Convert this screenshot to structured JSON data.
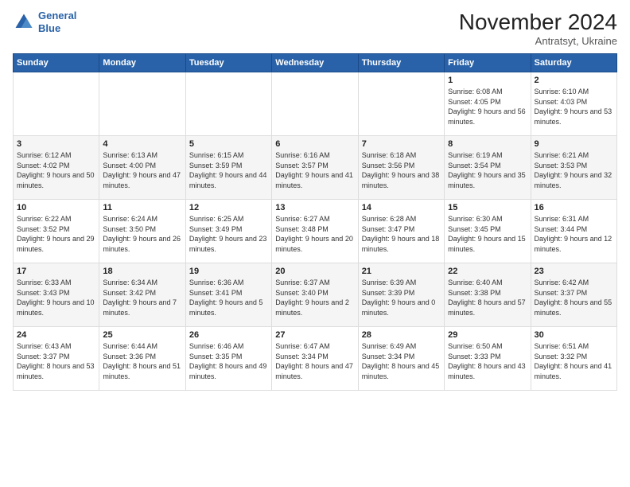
{
  "logo": {
    "line1": "General",
    "line2": "Blue"
  },
  "title": "November 2024",
  "subtitle": "Antratsyt, Ukraine",
  "headers": [
    "Sunday",
    "Monday",
    "Tuesday",
    "Wednesday",
    "Thursday",
    "Friday",
    "Saturday"
  ],
  "weeks": [
    [
      {
        "day": "",
        "info": ""
      },
      {
        "day": "",
        "info": ""
      },
      {
        "day": "",
        "info": ""
      },
      {
        "day": "",
        "info": ""
      },
      {
        "day": "",
        "info": ""
      },
      {
        "day": "1",
        "info": "Sunrise: 6:08 AM\nSunset: 4:05 PM\nDaylight: 9 hours and 56 minutes."
      },
      {
        "day": "2",
        "info": "Sunrise: 6:10 AM\nSunset: 4:03 PM\nDaylight: 9 hours and 53 minutes."
      }
    ],
    [
      {
        "day": "3",
        "info": "Sunrise: 6:12 AM\nSunset: 4:02 PM\nDaylight: 9 hours and 50 minutes."
      },
      {
        "day": "4",
        "info": "Sunrise: 6:13 AM\nSunset: 4:00 PM\nDaylight: 9 hours and 47 minutes."
      },
      {
        "day": "5",
        "info": "Sunrise: 6:15 AM\nSunset: 3:59 PM\nDaylight: 9 hours and 44 minutes."
      },
      {
        "day": "6",
        "info": "Sunrise: 6:16 AM\nSunset: 3:57 PM\nDaylight: 9 hours and 41 minutes."
      },
      {
        "day": "7",
        "info": "Sunrise: 6:18 AM\nSunset: 3:56 PM\nDaylight: 9 hours and 38 minutes."
      },
      {
        "day": "8",
        "info": "Sunrise: 6:19 AM\nSunset: 3:54 PM\nDaylight: 9 hours and 35 minutes."
      },
      {
        "day": "9",
        "info": "Sunrise: 6:21 AM\nSunset: 3:53 PM\nDaylight: 9 hours and 32 minutes."
      }
    ],
    [
      {
        "day": "10",
        "info": "Sunrise: 6:22 AM\nSunset: 3:52 PM\nDaylight: 9 hours and 29 minutes."
      },
      {
        "day": "11",
        "info": "Sunrise: 6:24 AM\nSunset: 3:50 PM\nDaylight: 9 hours and 26 minutes."
      },
      {
        "day": "12",
        "info": "Sunrise: 6:25 AM\nSunset: 3:49 PM\nDaylight: 9 hours and 23 minutes."
      },
      {
        "day": "13",
        "info": "Sunrise: 6:27 AM\nSunset: 3:48 PM\nDaylight: 9 hours and 20 minutes."
      },
      {
        "day": "14",
        "info": "Sunrise: 6:28 AM\nSunset: 3:47 PM\nDaylight: 9 hours and 18 minutes."
      },
      {
        "day": "15",
        "info": "Sunrise: 6:30 AM\nSunset: 3:45 PM\nDaylight: 9 hours and 15 minutes."
      },
      {
        "day": "16",
        "info": "Sunrise: 6:31 AM\nSunset: 3:44 PM\nDaylight: 9 hours and 12 minutes."
      }
    ],
    [
      {
        "day": "17",
        "info": "Sunrise: 6:33 AM\nSunset: 3:43 PM\nDaylight: 9 hours and 10 minutes."
      },
      {
        "day": "18",
        "info": "Sunrise: 6:34 AM\nSunset: 3:42 PM\nDaylight: 9 hours and 7 minutes."
      },
      {
        "day": "19",
        "info": "Sunrise: 6:36 AM\nSunset: 3:41 PM\nDaylight: 9 hours and 5 minutes."
      },
      {
        "day": "20",
        "info": "Sunrise: 6:37 AM\nSunset: 3:40 PM\nDaylight: 9 hours and 2 minutes."
      },
      {
        "day": "21",
        "info": "Sunrise: 6:39 AM\nSunset: 3:39 PM\nDaylight: 9 hours and 0 minutes."
      },
      {
        "day": "22",
        "info": "Sunrise: 6:40 AM\nSunset: 3:38 PM\nDaylight: 8 hours and 57 minutes."
      },
      {
        "day": "23",
        "info": "Sunrise: 6:42 AM\nSunset: 3:37 PM\nDaylight: 8 hours and 55 minutes."
      }
    ],
    [
      {
        "day": "24",
        "info": "Sunrise: 6:43 AM\nSunset: 3:37 PM\nDaylight: 8 hours and 53 minutes."
      },
      {
        "day": "25",
        "info": "Sunrise: 6:44 AM\nSunset: 3:36 PM\nDaylight: 8 hours and 51 minutes."
      },
      {
        "day": "26",
        "info": "Sunrise: 6:46 AM\nSunset: 3:35 PM\nDaylight: 8 hours and 49 minutes."
      },
      {
        "day": "27",
        "info": "Sunrise: 6:47 AM\nSunset: 3:34 PM\nDaylight: 8 hours and 47 minutes."
      },
      {
        "day": "28",
        "info": "Sunrise: 6:49 AM\nSunset: 3:34 PM\nDaylight: 8 hours and 45 minutes."
      },
      {
        "day": "29",
        "info": "Sunrise: 6:50 AM\nSunset: 3:33 PM\nDaylight: 8 hours and 43 minutes."
      },
      {
        "day": "30",
        "info": "Sunrise: 6:51 AM\nSunset: 3:32 PM\nDaylight: 8 hours and 41 minutes."
      }
    ]
  ]
}
